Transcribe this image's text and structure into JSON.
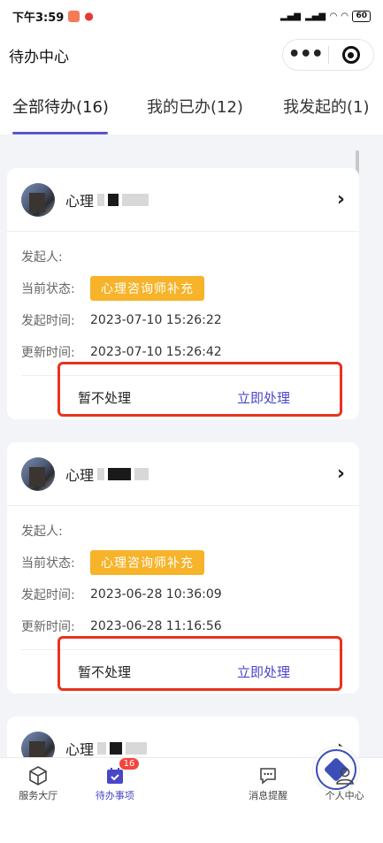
{
  "status_bar": {
    "time": "下午3:59",
    "battery": "60"
  },
  "header": {
    "title": "待办中心"
  },
  "tabs": [
    {
      "label": "全部待办(16)",
      "active": true
    },
    {
      "label": "我的已办(12)",
      "active": false
    },
    {
      "label": "我发起的(1)",
      "active": false
    }
  ],
  "cards": [
    {
      "name_prefix": "心理",
      "initiator_label": "发起人:",
      "initiator": "",
      "status_label": "当前状态:",
      "status": "心理咨询师补充",
      "created_label": "发起时间:",
      "created": "2023-07-10 15:26:22",
      "updated_label": "更新时间:",
      "updated": "2023-07-10 15:26:42",
      "skip_label": "暂不处理",
      "handle_label": "立即处理"
    },
    {
      "name_prefix": "心理",
      "initiator_label": "发起人:",
      "initiator": "",
      "status_label": "当前状态:",
      "status": "心理咨询师补充",
      "created_label": "发起时间:",
      "created": "2023-06-28 10:36:09",
      "updated_label": "更新时间:",
      "updated": "2023-06-28 11:16:56",
      "skip_label": "暂不处理",
      "handle_label": "立即处理"
    },
    {
      "name_prefix": "心理"
    }
  ],
  "tabbar": {
    "items": [
      {
        "label": "服务大厅",
        "icon": "cube-icon"
      },
      {
        "label": "待办事项",
        "icon": "calendar-check-icon",
        "badge": "16",
        "active": true
      },
      {
        "label": "",
        "icon": "school-logo-icon"
      },
      {
        "label": "消息提醒",
        "icon": "chat-bubble-icon"
      },
      {
        "label": "个人中心",
        "icon": "user-icon"
      }
    ]
  },
  "colors": {
    "accent": "#5a55d2",
    "badge": "#f7b329",
    "highlight_box": "#e8321e"
  }
}
